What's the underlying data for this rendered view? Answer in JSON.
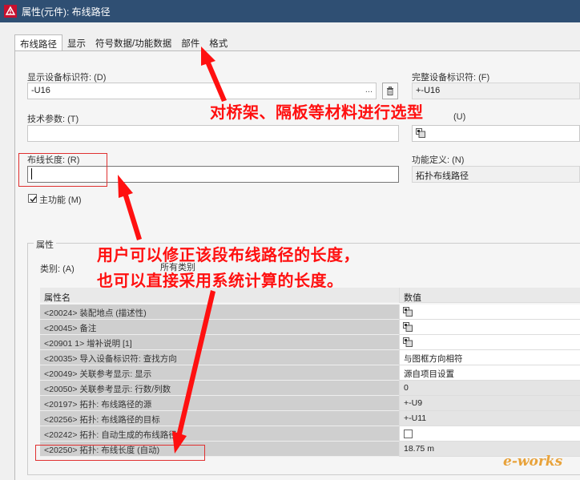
{
  "window": {
    "title": "属性(元件): 布线路径"
  },
  "tabs": [
    {
      "label": "布线路径"
    },
    {
      "label": "显示"
    },
    {
      "label": "符号数据/功能数据"
    },
    {
      "label": "部件"
    },
    {
      "label": "格式"
    }
  ],
  "form": {
    "display_id_label": "显示设备标识符: (D)",
    "display_id_value": "-U16",
    "full_id_label": "完整设备标识符: (F)",
    "full_id_value": "+-U16",
    "tech_params_label": "技术参数: (T)",
    "tech_params_value": "",
    "right_u_label": "(U)",
    "length_label": "布线长度: (R)",
    "length_value": "",
    "func_def_label": "功能定义: (N)",
    "func_def_value": "拓扑布线路径",
    "main_function_label": "主功能 (M)",
    "main_function_checked": true
  },
  "properties": {
    "group_label": "属性",
    "category_label": "类别: (A)",
    "category_value": "所有类别",
    "columns": {
      "name": "属性名",
      "value": "数值"
    },
    "rows": [
      {
        "name": "<20024> 装配地点 (描述性)",
        "value": "",
        "icon": "multilang-icon"
      },
      {
        "name": "<20045> 备注",
        "value": "",
        "icon": "multilang-icon"
      },
      {
        "name": "<20901 1> 增补说明 [1]",
        "value": "",
        "icon": "multilang-icon"
      },
      {
        "name": "<20035> 导入设备标识符: 查找方向",
        "value": "与图框方向相符"
      },
      {
        "name": "<20049> 关联参考显示: 显示",
        "value": "源自项目设置"
      },
      {
        "name": "<20050> 关联参考显示: 行数/列数",
        "value": "0"
      },
      {
        "name": "<20197> 拓扑: 布线路径的源",
        "value": "+-U9"
      },
      {
        "name": "<20256> 拓扑: 布线路径的目标",
        "value": "+-U11"
      },
      {
        "name": "<20242> 拓扑: 自动生成的布线路径",
        "value": "",
        "checkbox": true
      },
      {
        "name": "<20250> 拓扑: 布线长度 (自动)",
        "value": "18.75 m"
      }
    ]
  },
  "annotations": {
    "top_note": "对桥架、隔板等材料进行选型",
    "bottom_note_line1": "用户可以修正该段布线路径的长度，",
    "bottom_note_line2": "也可以直接采用系统计算的长度。"
  },
  "watermark": {
    "text": "e-works"
  },
  "colors": {
    "titlebar": "#2f4f73",
    "annotation": "#ff1010",
    "highlight_box": "#e03030"
  }
}
